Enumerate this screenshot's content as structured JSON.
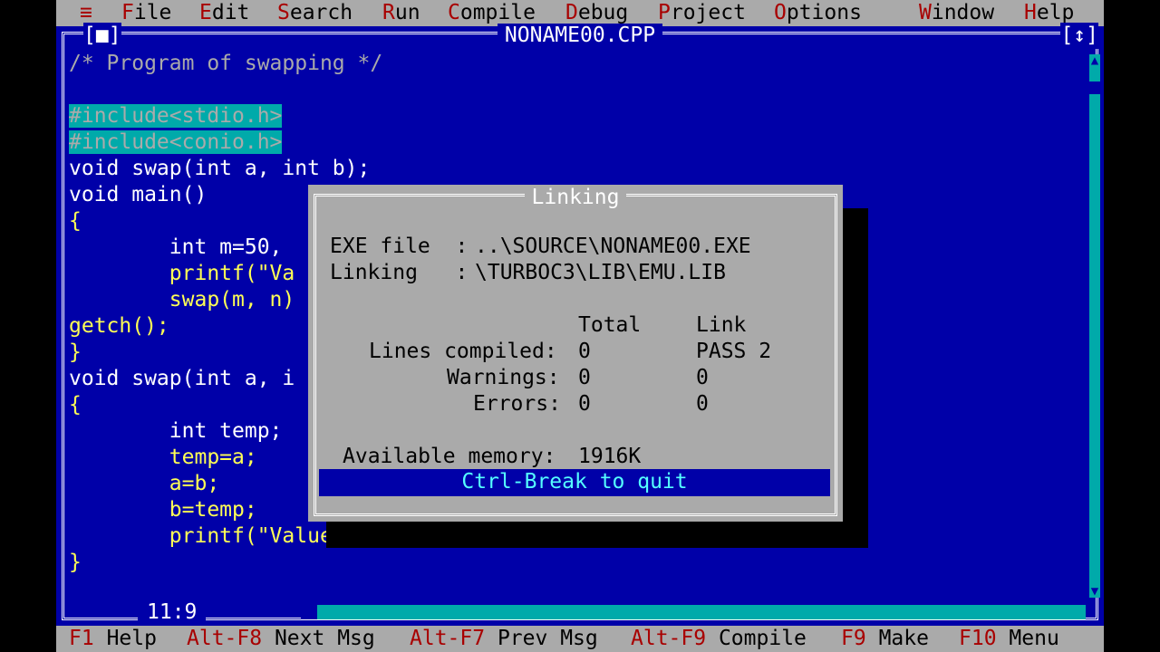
{
  "menu": {
    "system": "≡",
    "items": [
      {
        "hotkey": "F",
        "rest": "ile"
      },
      {
        "hotkey": "E",
        "rest": "dit"
      },
      {
        "hotkey": "S",
        "rest": "earch"
      },
      {
        "hotkey": "R",
        "rest": "un"
      },
      {
        "hotkey": "C",
        "rest": "ompile"
      },
      {
        "hotkey": "D",
        "rest": "ebug"
      },
      {
        "hotkey": "P",
        "rest": "roject"
      },
      {
        "hotkey": "O",
        "rest": "ptions"
      },
      {
        "hotkey": "W",
        "rest": "indow"
      },
      {
        "hotkey": "H",
        "rest": "elp"
      }
    ]
  },
  "editor": {
    "filename": "NONAME00.CPP",
    "close_box": "[■]",
    "zoom_box": "[↕]",
    "cursor_pos": "11:9",
    "lines": [
      "/* Program of swapping */",
      "",
      "#include<stdio.h>",
      "#include<conio.h>",
      "void swap(int a, int b);",
      "void main()",
      "{",
      "        int m=50,",
      "        printf(\"Va",
      "        swap(m, n)",
      "getch();",
      "}",
      "void swap(int a, i",
      "{",
      "        int temp;",
      "        temp=a;",
      "        a=b;",
      "        b=temp;",
      "        printf(\"Value after swap m=%d and n=%d\", a, b);",
      "}"
    ]
  },
  "dialog": {
    "title": "Linking",
    "exe_label": "EXE file  :",
    "exe_value": "..\\SOURCE\\NONAME00.EXE",
    "linking_label": "Linking   :",
    "linking_value": "\\TURBOC3\\LIB\\EMU.LIB",
    "col_total": "Total",
    "col_link": "Link",
    "rows": [
      {
        "label": "Lines compiled:",
        "total": "0",
        "link": "PASS 2"
      },
      {
        "label": "Warnings:",
        "total": "0",
        "link": "0"
      },
      {
        "label": "Errors:",
        "total": "0",
        "link": "0"
      }
    ],
    "memory_label": "Available memory:",
    "memory_value": "1916K",
    "quit_text": "Ctrl-Break to quit"
  },
  "keybar": [
    {
      "key": "F1",
      "label": "Help"
    },
    {
      "key": "Alt-F8",
      "label": "Next Msg"
    },
    {
      "key": "Alt-F7",
      "label": "Prev Msg"
    },
    {
      "key": "Alt-F9",
      "label": "Compile"
    },
    {
      "key": "F9",
      "label": "Make"
    },
    {
      "key": "F10",
      "label": "Menu"
    }
  ],
  "colors": {
    "background": "#0000a8",
    "menu": "#aaaaaa",
    "hotkey": "#a80000",
    "keyword": "#ffff55",
    "highlight": "#00aaaa"
  }
}
